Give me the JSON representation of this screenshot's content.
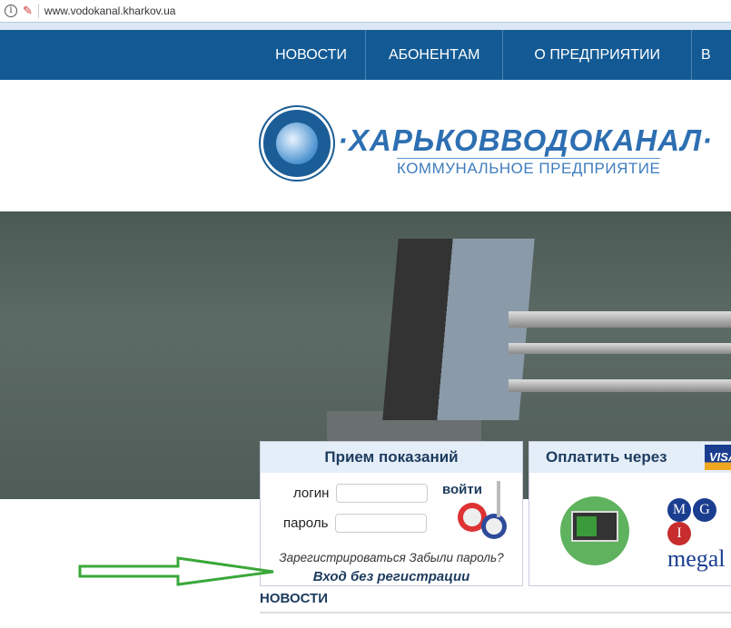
{
  "browser": {
    "url": "www.vodokanal.kharkov.ua"
  },
  "nav": {
    "items": [
      "НОВОСТИ",
      "АБОНЕНТАМ",
      "О ПРЕДПРИЯТИИ",
      "В"
    ]
  },
  "header": {
    "brand": "·ХАРЬКОВВОДОКАНАЛ·",
    "subtitle": "КОММУНАЛЬНОЕ ПРЕДПРИЯТИЕ"
  },
  "login": {
    "title": "Прием показаний",
    "login_label": "логин",
    "password_label": "пароль",
    "enter": "войти",
    "register": "Зарегистрироваться",
    "forgot": "Забыли пароль?",
    "guest": "Вход без регистрации"
  },
  "pay": {
    "title": "Оплатить через",
    "visa": "VISA",
    "mg_letters": [
      "M",
      "G",
      "I"
    ],
    "mg_text": "megal"
  },
  "news": {
    "title": "НОВОСТИ"
  },
  "colors": {
    "nav": "#135a94",
    "accent": "#1d3b5e",
    "arrow": "#3aa83a"
  }
}
